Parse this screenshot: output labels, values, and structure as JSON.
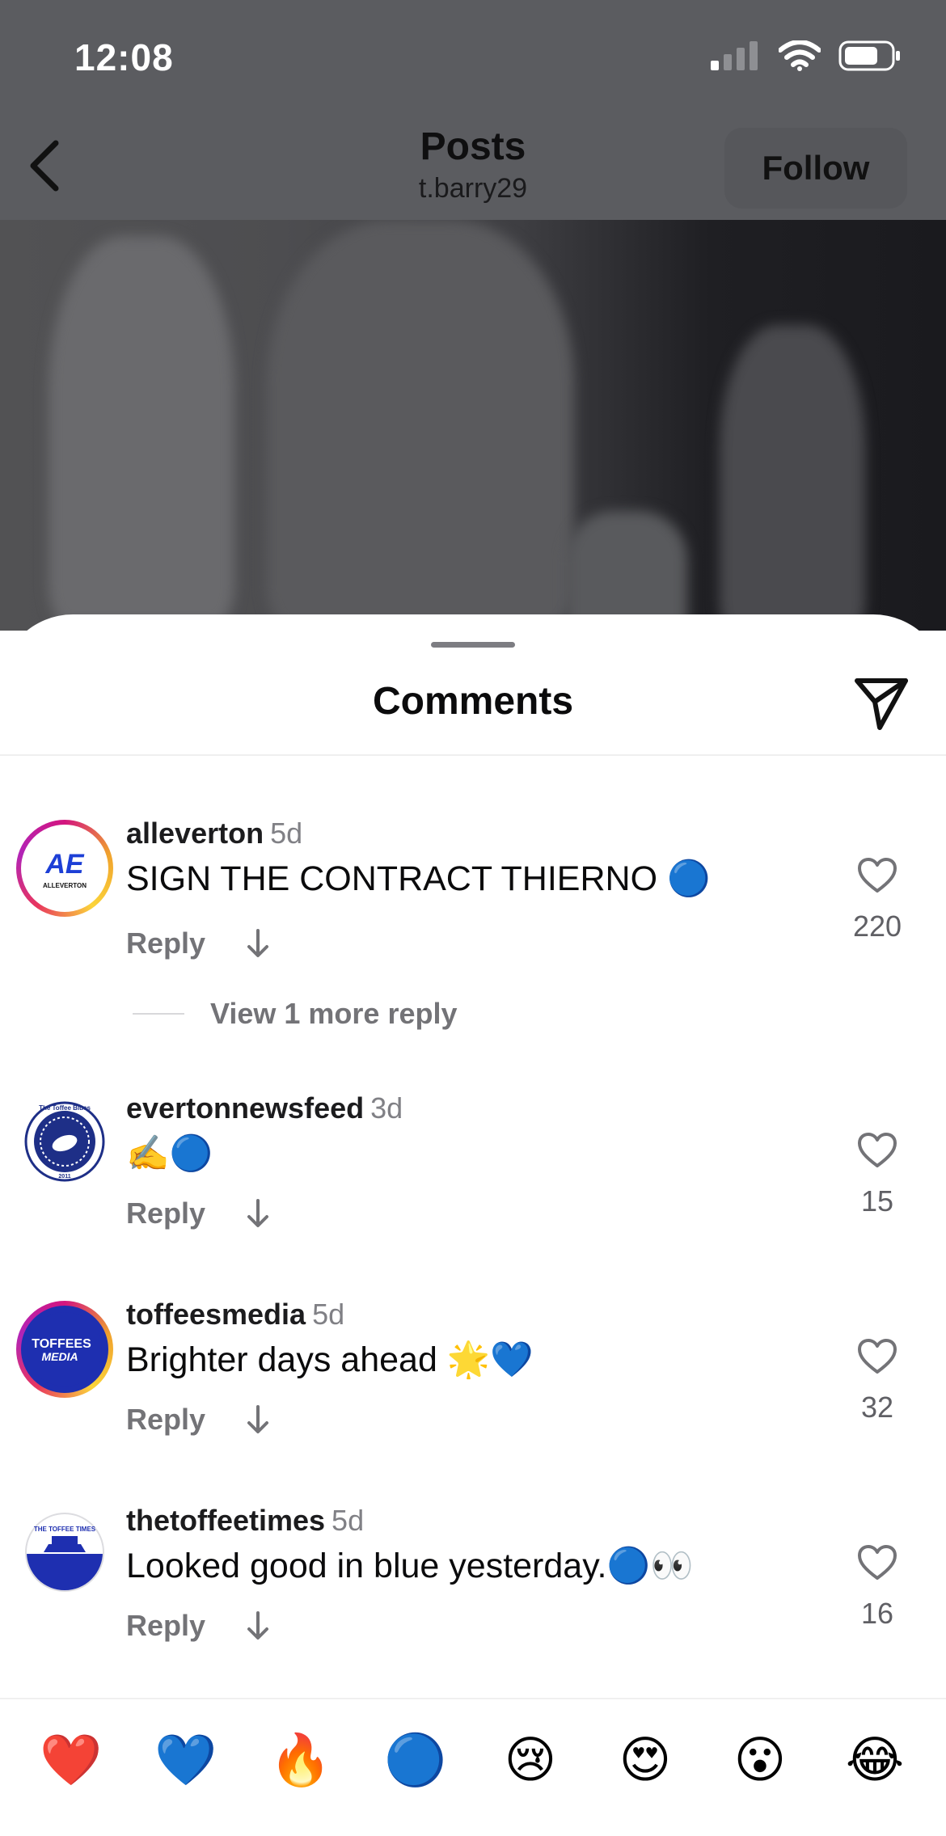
{
  "status_bar": {
    "time": "12:08"
  },
  "nav": {
    "title": "Posts",
    "subtitle": "t.barry29",
    "follow_label": "Follow"
  },
  "sheet": {
    "title": "Comments"
  },
  "comments": [
    {
      "username": "alleverton",
      "ago": "5d",
      "text": "SIGN THE CONTRACT THIERNO 🔵",
      "reply_label": "Reply",
      "likes": "220",
      "avatar_text": "AE",
      "avatar_caption": "ALLEVERTON"
    },
    {
      "username": "evertonnewsfeed",
      "ago": "3d",
      "text": "✍️🔵",
      "reply_label": "Reply",
      "likes": "15",
      "avatar_text": "The Toffee Blues",
      "avatar_caption": "2011"
    },
    {
      "username": "toffeesmedia",
      "ago": "5d",
      "text": "Brighter days ahead 🌟💙",
      "reply_label": "Reply",
      "likes": "32",
      "avatar_text": "TOFFEES",
      "avatar_caption": "MEDIA"
    },
    {
      "username": "thetoffeetimes",
      "ago": "5d",
      "text": "Looked good in blue yesterday.🔵👀",
      "reply_label": "Reply",
      "likes": "16",
      "avatar_text": "THE TOFFEE TIMES"
    }
  ],
  "view_more_replies": "View 1 more reply",
  "emoji_bar": [
    "❤️",
    "💙",
    "🔥",
    "🔵",
    "😢",
    "😍",
    "😮",
    "😂"
  ],
  "icons": {
    "back": "chevron-left-icon",
    "share": "paper-plane-icon",
    "like": "heart-outline-icon",
    "translate": "arrow-down-icon"
  },
  "colors": {
    "dim_overlay": "#5b5c60",
    "muted_text": "#737377",
    "ring_gradient": [
      "#d3157f",
      "#f0a22d",
      "#fbd43a"
    ]
  }
}
